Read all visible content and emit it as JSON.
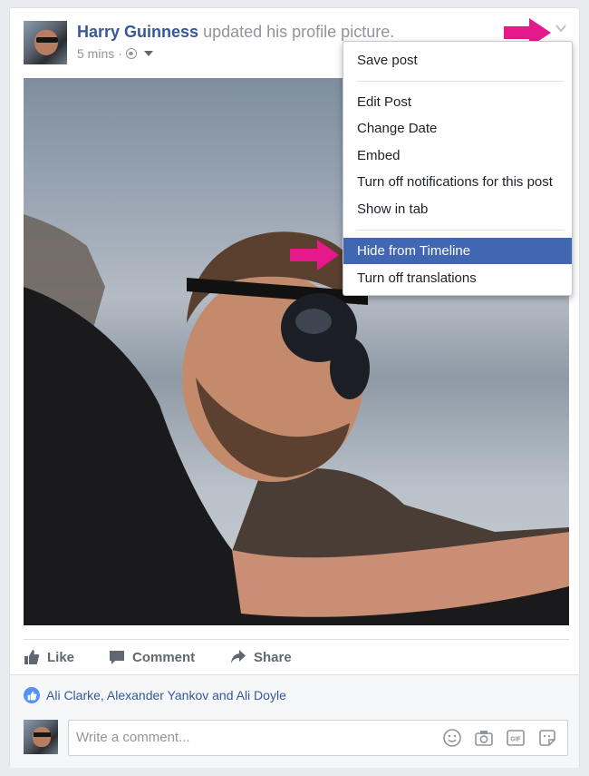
{
  "post": {
    "author": "Harry Guinness",
    "action": "updated his profile picture.",
    "time": "5 mins",
    "separator": "·"
  },
  "menu": {
    "items": [
      {
        "label": "Save post"
      },
      {
        "label": "Edit Post"
      },
      {
        "label": "Change Date"
      },
      {
        "label": "Embed"
      },
      {
        "label": "Turn off notifications for this post"
      },
      {
        "label": "Show in tab"
      },
      {
        "label": "Hide from Timeline",
        "highlighted": true
      },
      {
        "label": "Turn off translations"
      }
    ]
  },
  "actions": {
    "like": "Like",
    "comment": "Comment",
    "share": "Share"
  },
  "likes": {
    "text": "Ali Clarke, Alexander Yankov and Ali Doyle"
  },
  "comment_box": {
    "placeholder": "Write a comment..."
  },
  "icons": [
    "globe-icon",
    "audience-caret-icon",
    "chevron-down-icon",
    "like-icon",
    "comment-icon",
    "share-icon",
    "emoji-icon",
    "camera-icon",
    "gif-icon",
    "sticker-icon"
  ],
  "colors": {
    "link": "#365899",
    "menu_highlight": "#4267b2",
    "annotation_arrow": "#e5198b",
    "muted_text": "#90949c"
  }
}
